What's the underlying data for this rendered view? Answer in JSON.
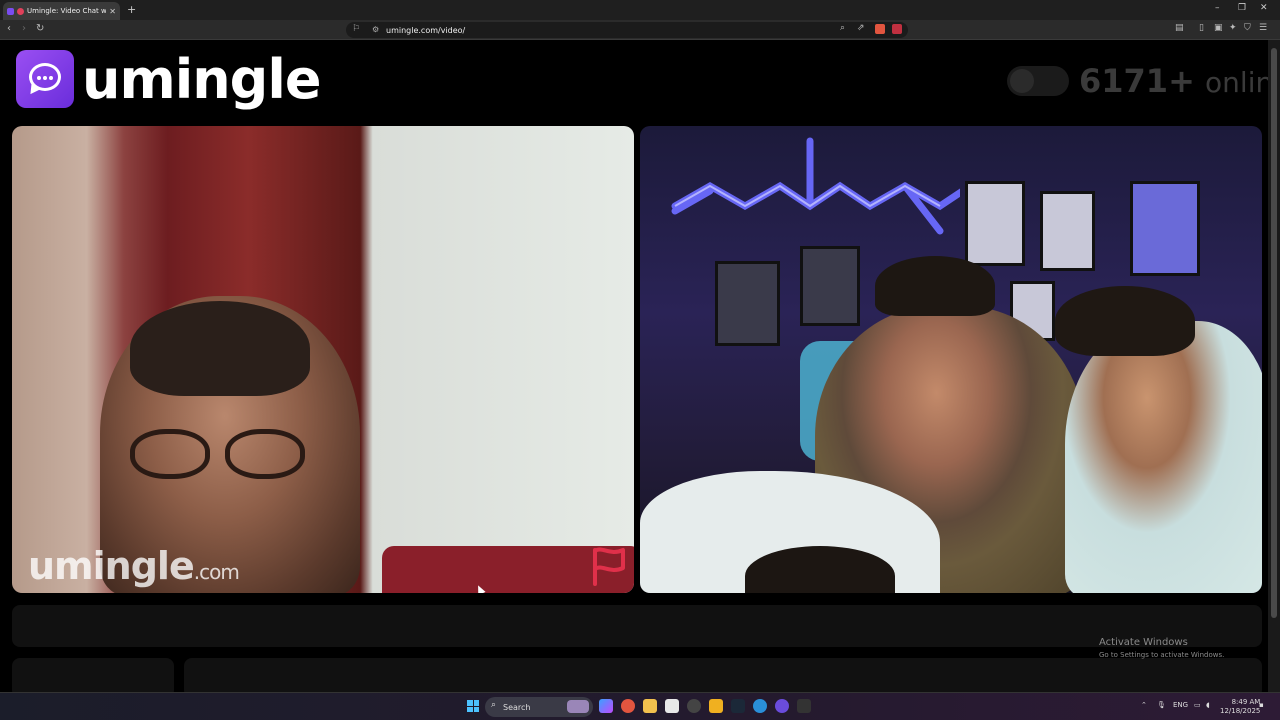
{
  "browser": {
    "tab_title": "Umingle: Video Chat with Str",
    "url": "umingle.com/video/"
  },
  "site": {
    "brand": "umingle",
    "online_count": "6171",
    "online_plus": "+",
    "online_word": "online"
  },
  "video": {
    "watermark_name": "umingle",
    "watermark_tld": ".com"
  },
  "windows_notice": {
    "line1": "Activate Windows",
    "line2": "Go to Settings to activate Windows."
  },
  "taskbar": {
    "search_placeholder": "Search",
    "language": "ENG",
    "time": "8:49 AM",
    "date": "12/18/2025"
  },
  "colors": {
    "brand_purple": "#7a3ae6",
    "report_red": "#e0304a"
  }
}
